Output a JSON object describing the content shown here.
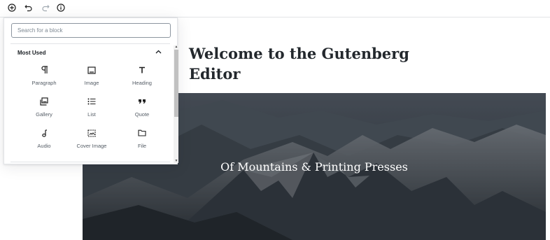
{
  "toolbar": {
    "buttons": [
      {
        "name": "add-block-icon",
        "icon": "plus-circle"
      },
      {
        "name": "undo-icon",
        "icon": "undo-arrow"
      },
      {
        "name": "redo-icon",
        "icon": "redo-arrow"
      },
      {
        "name": "info-icon",
        "icon": "info-circle"
      }
    ]
  },
  "inserter": {
    "search_placeholder": "Search for a block",
    "panel_title": "Most Used",
    "panel_toggle": "^",
    "blocks": [
      {
        "label": "Paragraph",
        "icon": "paragraph-icon"
      },
      {
        "label": "Image",
        "icon": "image-icon"
      },
      {
        "label": "Heading",
        "icon": "heading-icon"
      },
      {
        "label": "Gallery",
        "icon": "gallery-icon"
      },
      {
        "label": "List",
        "icon": "list-icon"
      },
      {
        "label": "Quote",
        "icon": "quote-icon"
      },
      {
        "label": "Audio",
        "icon": "audio-icon"
      },
      {
        "label": "Cover Image",
        "icon": "cover-image-icon"
      },
      {
        "label": "File",
        "icon": "file-icon"
      }
    ]
  },
  "editor": {
    "post_title": "Welcome to the Gutenberg Editor",
    "cover_title": "Of Mountains & Printing Presses"
  },
  "colors": {
    "text": "#23282d",
    "border": "#e2e4e7",
    "cover_overlay": "#3d4650"
  }
}
